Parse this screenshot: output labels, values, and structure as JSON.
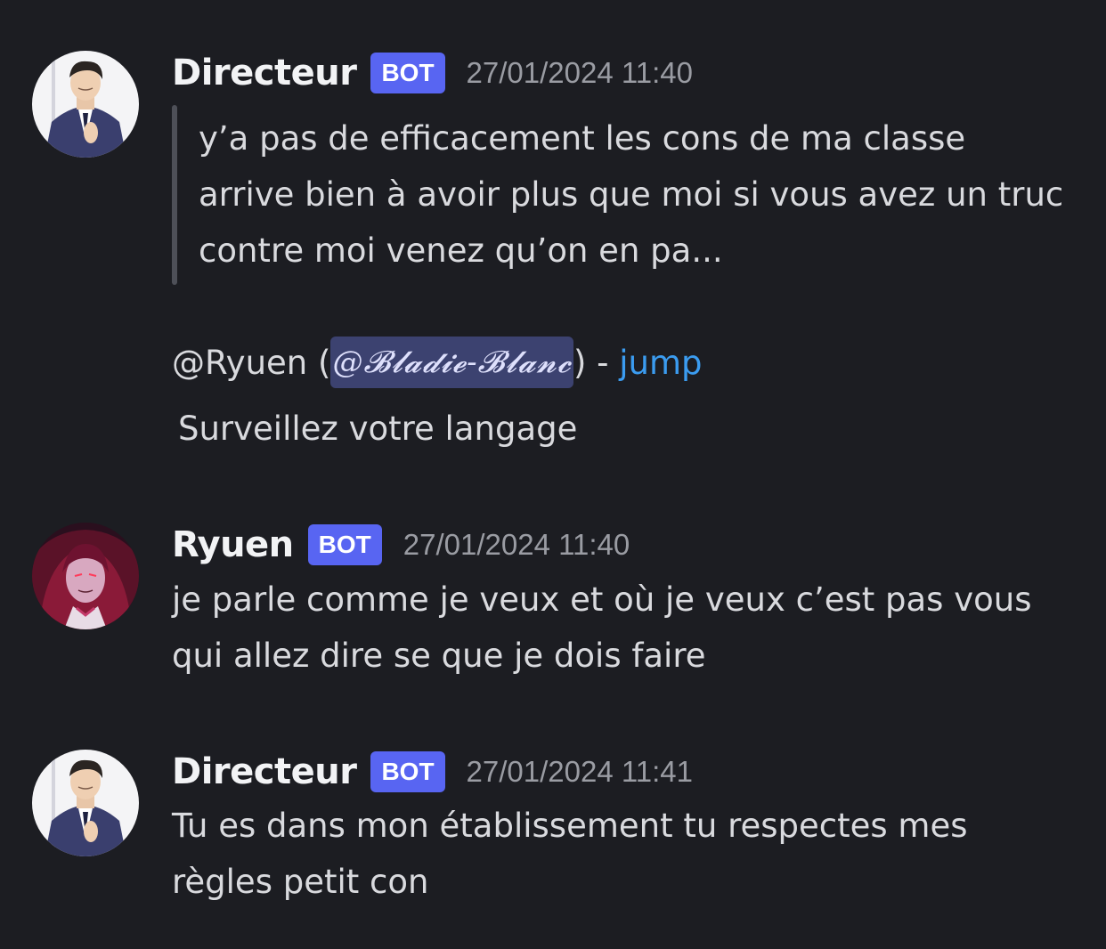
{
  "messages": [
    {
      "author": "Directeur",
      "tag": "BOT",
      "timestamp": "27/01/2024 11:40",
      "avatar_icon": "suited-man-avatar",
      "quote": "y’a pas de efficacement les cons de ma classe arrive bien à avoir plus que moi si vous avez un truc contre moi venez qu’on en pa...",
      "reply": {
        "prefix": "@Ryuen (",
        "mention": "@𝓑𝓵𝓪𝓭𝓲𝓮-𝓑𝓵𝓪𝓷𝓬",
        "suffix": ") - ",
        "link": "jump"
      },
      "text": "Surveillez votre langage"
    },
    {
      "author": "Ryuen",
      "tag": "BOT",
      "timestamp": "27/01/2024 11:40",
      "avatar_icon": "red-haired-character-avatar",
      "text": "je parle comme je veux et où je veux c’est pas vous qui allez dire se que je dois faire"
    },
    {
      "author": "Directeur",
      "tag": "BOT",
      "timestamp": "27/01/2024 11:41",
      "avatar_icon": "suited-man-avatar",
      "text": "Tu es dans mon établissement tu respectes mes règles petit con"
    }
  ],
  "colors": {
    "background": "#1c1d22",
    "bot_tag": "#5865f2",
    "mention_bg": "#3c4270",
    "link": "#3b9cf0"
  }
}
